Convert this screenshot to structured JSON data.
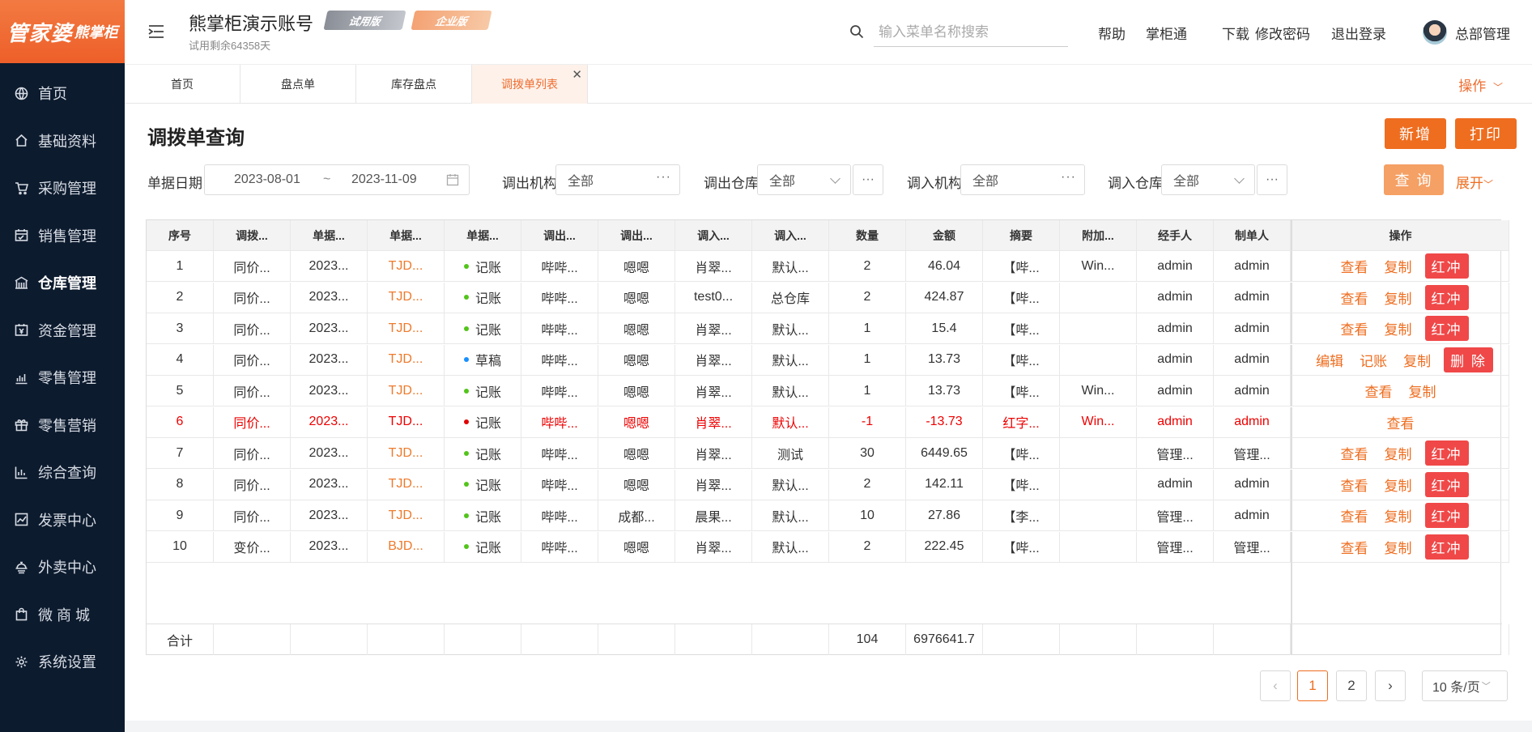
{
  "brand": {
    "logo_main": "管家婆",
    "logo_sub": "熊掌柜"
  },
  "sidebar": {
    "items": [
      {
        "label": "首页",
        "icon": "globe-icon"
      },
      {
        "label": "基础资料",
        "icon": "home-icon"
      },
      {
        "label": "采购管理",
        "icon": "cart-icon"
      },
      {
        "label": "销售管理",
        "icon": "calendar-icon"
      },
      {
        "label": "仓库管理",
        "icon": "warehouse-icon"
      },
      {
        "label": "资金管理",
        "icon": "cash-icon"
      },
      {
        "label": "零售管理",
        "icon": "bar-chart-icon"
      },
      {
        "label": "零售营销",
        "icon": "gift-icon"
      },
      {
        "label": "综合查询",
        "icon": "stats-icon"
      },
      {
        "label": "发票中心",
        "icon": "trend-icon"
      },
      {
        "label": "外卖中心",
        "icon": "delivery-icon"
      },
      {
        "label": "微 商 城",
        "icon": "bag-icon"
      },
      {
        "label": "系统设置",
        "icon": "gear-icon"
      }
    ],
    "active_index": 4
  },
  "header": {
    "account_title": "熊掌柜演示账号",
    "badge_trial": "试用版",
    "badge_enterprise": "企业版",
    "trial_remaining": "试用剩余64358天",
    "search_placeholder": "输入菜单名称搜索",
    "links": [
      "帮助",
      "掌柜通",
      "下载",
      "修改密码",
      "退出登录"
    ],
    "user_name": "总部管理"
  },
  "tabs": {
    "items": [
      "首页",
      "盘点单",
      "库存盘点",
      "调拨单列表"
    ],
    "active_index": 3,
    "ops_label": "操作"
  },
  "page": {
    "title": "调拨单查询",
    "add_label": "新增",
    "print_label": "打印",
    "query_label": "查 询",
    "expand_label": "展开"
  },
  "filters": {
    "date_label": "单据日期",
    "date_from": "2023-08-01",
    "date_sep": "~",
    "date_to": "2023-11-09",
    "out_org_label": "调出机构",
    "out_org_value": "全部",
    "out_wh_label": "调出仓库",
    "out_wh_value": "全部",
    "in_org_label": "调入机构",
    "in_org_value": "全部",
    "in_wh_label": "调入仓库",
    "in_wh_value": "全部"
  },
  "table": {
    "headers": [
      "序号",
      "调拨...",
      "单据...",
      "单据...",
      "单据...",
      "调出...",
      "调出...",
      "调入...",
      "调入...",
      "数量",
      "金额",
      "摘要",
      "附加...",
      "经手人",
      "制单人",
      "操作"
    ],
    "rows": [
      {
        "no": "1",
        "type": "同价...",
        "date": "2023...",
        "code": "TJD...",
        "status": "记账",
        "status_color": "#52c41a",
        "out_org": "哔哔...",
        "out_wh": "嗯嗯",
        "in_org": "肖翠...",
        "in_wh": "默认...",
        "qty": "2",
        "amount": "46.04",
        "memo": "【哔...",
        "extra": "Win...",
        "handler": "admin",
        "maker": "admin",
        "actions": [
          "查看",
          "复制"
        ],
        "red_action": "红冲",
        "is_red": false
      },
      {
        "no": "2",
        "type": "同价...",
        "date": "2023...",
        "code": "TJD...",
        "status": "记账",
        "status_color": "#52c41a",
        "out_org": "哔哔...",
        "out_wh": "嗯嗯",
        "in_org": "test0...",
        "in_wh": "总仓库",
        "qty": "2",
        "amount": "424.87",
        "memo": "【哔...",
        "extra": "",
        "handler": "admin",
        "maker": "admin",
        "actions": [
          "查看",
          "复制"
        ],
        "red_action": "红冲",
        "is_red": false
      },
      {
        "no": "3",
        "type": "同价...",
        "date": "2023...",
        "code": "TJD...",
        "status": "记账",
        "status_color": "#52c41a",
        "out_org": "哔哔...",
        "out_wh": "嗯嗯",
        "in_org": "肖翠...",
        "in_wh": "默认...",
        "qty": "1",
        "amount": "15.4",
        "memo": "【哔...",
        "extra": "",
        "handler": "admin",
        "maker": "admin",
        "actions": [
          "查看",
          "复制"
        ],
        "red_action": "红冲",
        "is_red": false
      },
      {
        "no": "4",
        "type": "同价...",
        "date": "2023...",
        "code": "TJD...",
        "status": "草稿",
        "status_color": "#1890ff",
        "out_org": "哔哔...",
        "out_wh": "嗯嗯",
        "in_org": "肖翠...",
        "in_wh": "默认...",
        "qty": "1",
        "amount": "13.73",
        "memo": "【哔...",
        "extra": "",
        "handler": "admin",
        "maker": "admin",
        "actions": [
          "编辑",
          "记账",
          "复制"
        ],
        "red_action": "删 除",
        "is_red": false
      },
      {
        "no": "5",
        "type": "同价...",
        "date": "2023...",
        "code": "TJD...",
        "status": "记账",
        "status_color": "#52c41a",
        "out_org": "哔哔...",
        "out_wh": "嗯嗯",
        "in_org": "肖翠...",
        "in_wh": "默认...",
        "qty": "1",
        "amount": "13.73",
        "memo": "【哔...",
        "extra": "Win...",
        "handler": "admin",
        "maker": "admin",
        "actions": [
          "查看",
          "复制"
        ],
        "red_action": "",
        "is_red": false
      },
      {
        "no": "6",
        "type": "同价...",
        "date": "2023...",
        "code": "TJD...",
        "status": "记账",
        "status_color": "#e00000",
        "out_org": "哔哔...",
        "out_wh": "嗯嗯",
        "in_org": "肖翠...",
        "in_wh": "默认...",
        "qty": "-1",
        "amount": "-13.73",
        "memo": "红字...",
        "extra": "Win...",
        "handler": "admin",
        "maker": "admin",
        "actions": [
          "查看"
        ],
        "red_action": "",
        "is_red": true
      },
      {
        "no": "7",
        "type": "同价...",
        "date": "2023...",
        "code": "TJD...",
        "status": "记账",
        "status_color": "#52c41a",
        "out_org": "哔哔...",
        "out_wh": "嗯嗯",
        "in_org": "肖翠...",
        "in_wh": "测试",
        "qty": "30",
        "amount": "6449.65",
        "memo": "【哔...",
        "extra": "",
        "handler": "管理...",
        "maker": "管理...",
        "actions": [
          "查看",
          "复制"
        ],
        "red_action": "红冲",
        "is_red": false
      },
      {
        "no": "8",
        "type": "同价...",
        "date": "2023...",
        "code": "TJD...",
        "status": "记账",
        "status_color": "#52c41a",
        "out_org": "哔哔...",
        "out_wh": "嗯嗯",
        "in_org": "肖翠...",
        "in_wh": "默认...",
        "qty": "2",
        "amount": "142.11",
        "memo": "【哔...",
        "extra": "",
        "handler": "admin",
        "maker": "admin",
        "actions": [
          "查看",
          "复制"
        ],
        "red_action": "红冲",
        "is_red": false
      },
      {
        "no": "9",
        "type": "同价...",
        "date": "2023...",
        "code": "TJD...",
        "status": "记账",
        "status_color": "#52c41a",
        "out_org": "哔哔...",
        "out_wh": "成都...",
        "in_org": "晨果...",
        "in_wh": "默认...",
        "qty": "10",
        "amount": "27.86",
        "memo": "【李...",
        "extra": "",
        "handler": "管理...",
        "maker": "admin",
        "actions": [
          "查看",
          "复制"
        ],
        "red_action": "红冲",
        "is_red": false
      },
      {
        "no": "10",
        "type": "变价...",
        "date": "2023...",
        "code": "BJD...",
        "status": "记账",
        "status_color": "#52c41a",
        "out_org": "哔哔...",
        "out_wh": "嗯嗯",
        "in_org": "肖翠...",
        "in_wh": "默认...",
        "qty": "2",
        "amount": "222.45",
        "memo": "【哔...",
        "extra": "",
        "handler": "管理...",
        "maker": "管理...",
        "actions": [
          "查看",
          "复制"
        ],
        "red_action": "红冲",
        "is_red": false
      }
    ],
    "footer": {
      "label": "合计",
      "qty": "104",
      "amount": "6976641.7"
    }
  },
  "pagination": {
    "pages": [
      "1",
      "2"
    ],
    "current": "1",
    "page_size": "10 条/页"
  },
  "colors": {
    "accent": "#ee6d1f",
    "sidebar_bg": "#0d1b2e",
    "danger": "#f04848",
    "link_orange": "#ee7a2c"
  }
}
